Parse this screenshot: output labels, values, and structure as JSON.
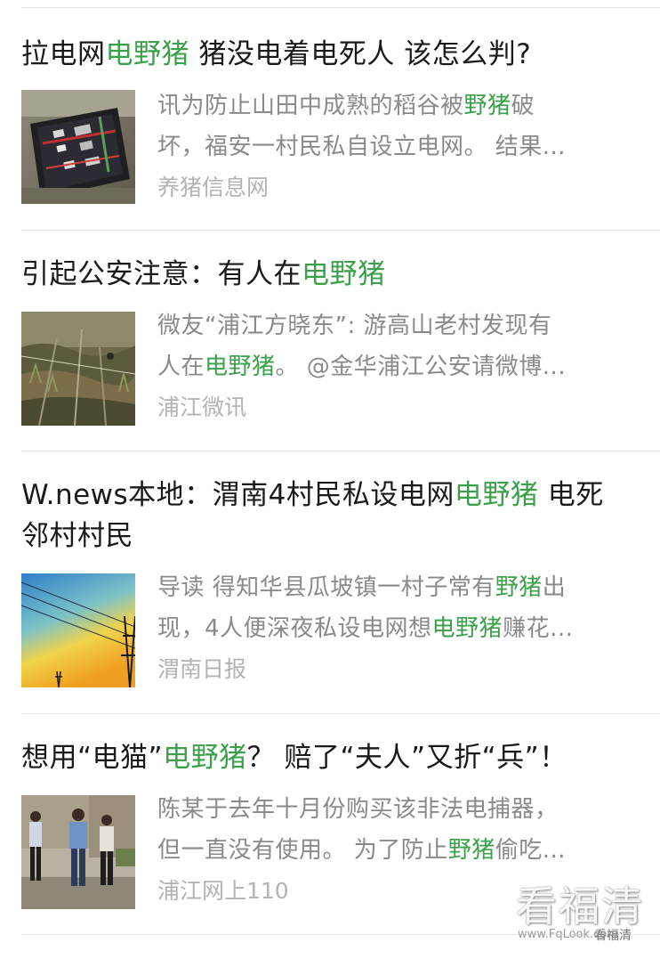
{
  "colors": {
    "highlight": "#3aa14a",
    "title": "#1a1a1a",
    "snippet": "#8a8a8a",
    "source": "#b3b3b3"
  },
  "articles": [
    {
      "title_parts": [
        {
          "text": "拉电网",
          "hl": false
        },
        {
          "text": "电野猪",
          "hl": true
        },
        {
          "text": " 猪没电着电死人 该怎么判?",
          "hl": false
        }
      ],
      "snippet_lines": [
        [
          {
            "text": "讯为防止山田中成熟的稻谷被",
            "hl": false
          },
          {
            "text": "野猪",
            "hl": true
          },
          {
            "text": "破",
            "hl": false
          }
        ],
        [
          {
            "text": "坏，福安一村民私自设立电网。 结果...",
            "hl": false
          }
        ]
      ],
      "source": "养猪信息网",
      "thumb": "electric-box-photo"
    },
    {
      "title_parts": [
        {
          "text": "引起公安注意：有人在",
          "hl": false
        },
        {
          "text": "电野猪",
          "hl": true
        }
      ],
      "snippet_lines": [
        [
          {
            "text": "微友“浦江方晓东”: 游高山老村发现有",
            "hl": false
          }
        ],
        [
          {
            "text": "人在",
            "hl": false
          },
          {
            "text": "电野猪",
            "hl": true
          },
          {
            "text": "。 @金华浦江公安请微博...",
            "hl": false
          }
        ]
      ],
      "source": "浦江微讯",
      "thumb": "hillside-wire-photo"
    },
    {
      "title_parts": [
        {
          "text": "W.news本地：渭南4村民私设电网",
          "hl": false
        },
        {
          "text": "电野猪",
          "hl": true
        },
        {
          "text": " 电死邻村村民",
          "hl": false
        }
      ],
      "snippet_lines": [
        [
          {
            "text": "导读 得知华县瓜坡镇一村子常有",
            "hl": false
          },
          {
            "text": "野猪",
            "hl": true
          },
          {
            "text": "出",
            "hl": false
          }
        ],
        [
          {
            "text": "现，4人便深夜私设电网想",
            "hl": false
          },
          {
            "text": "电野猪",
            "hl": true
          },
          {
            "text": "赚花...",
            "hl": false
          }
        ]
      ],
      "source": "渭南日报",
      "thumb": "power-line-sky-photo"
    },
    {
      "title_parts": [
        {
          "text": "想用“电猫”",
          "hl": false
        },
        {
          "text": "电野猪",
          "hl": true
        },
        {
          "text": "？ 赔了“夫人”又折“兵”！",
          "hl": false
        }
      ],
      "snippet_lines": [
        [
          {
            "text": "陈某于去年十月份购买该非法电捕器，",
            "hl": false
          }
        ],
        [
          {
            "text": "但一直没有使用。 为了防止",
            "hl": false
          },
          {
            "text": "野猪",
            "hl": true
          },
          {
            "text": "偷吃...",
            "hl": false
          }
        ]
      ],
      "source": "浦江网上110",
      "thumb": "people-outdoors-photo"
    }
  ],
  "watermark": {
    "big": "看福清",
    "url": "www.FqLook.com",
    "small": "看福清"
  }
}
